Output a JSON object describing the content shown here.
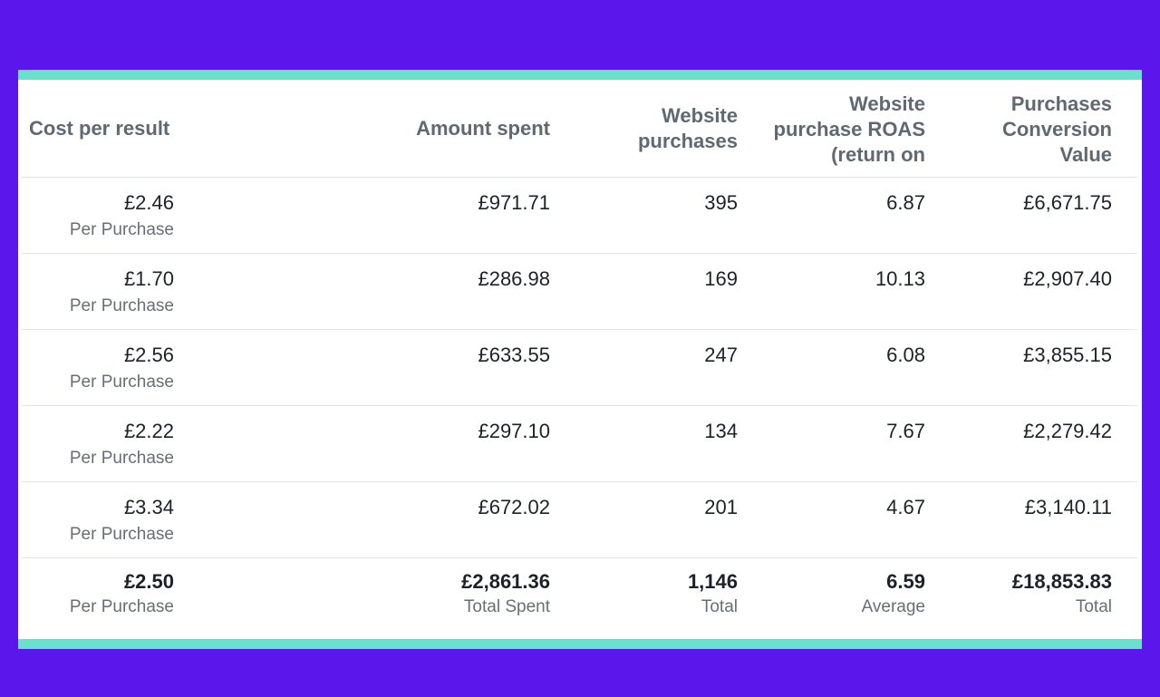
{
  "headers": {
    "cost_per_result": "Cost per result",
    "amount_spent": "Amount spent",
    "website_purchases": "Website purchases",
    "roas": "Website purchase ROAS (return on",
    "conversion_value": "Purchases Conversion Value"
  },
  "rows": [
    {
      "cost": "£2.46",
      "cost_sub": "Per Purchase",
      "spent": "£971.71",
      "purchases": "395",
      "roas": "6.87",
      "value": "£6,671.75"
    },
    {
      "cost": "£1.70",
      "cost_sub": "Per Purchase",
      "spent": "£286.98",
      "purchases": "169",
      "roas": "10.13",
      "value": "£2,907.40"
    },
    {
      "cost": "£2.56",
      "cost_sub": "Per Purchase",
      "spent": "£633.55",
      "purchases": "247",
      "roas": "6.08",
      "value": "£3,855.15"
    },
    {
      "cost": "£2.22",
      "cost_sub": "Per Purchase",
      "spent": "£297.10",
      "purchases": "134",
      "roas": "7.67",
      "value": "£2,279.42"
    },
    {
      "cost": "£3.34",
      "cost_sub": "Per Purchase",
      "spent": "£672.02",
      "purchases": "201",
      "roas": "4.67",
      "value": "£3,140.11"
    }
  ],
  "totals": {
    "cost": "£2.50",
    "cost_sub": "Per Purchase",
    "spent": "£2,861.36",
    "spent_sub": "Total Spent",
    "purchases": "1,146",
    "purchases_sub": "Total",
    "roas": "6.59",
    "roas_sub": "Average",
    "value": "£18,853.83",
    "value_sub": "Total"
  },
  "colors": {
    "background": "#5b16ec",
    "accent_border": "#67e0cc",
    "header_text": "#5f6873",
    "value_text": "#1d2129"
  }
}
